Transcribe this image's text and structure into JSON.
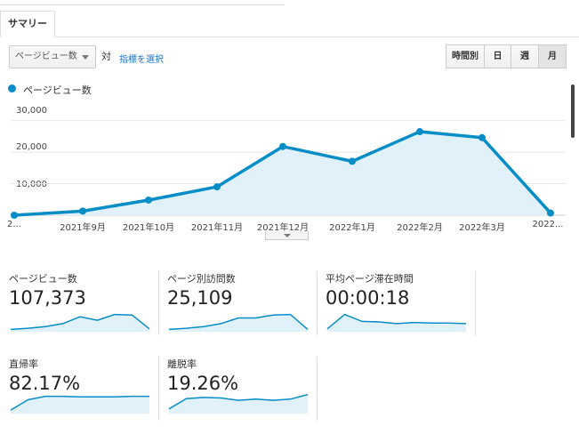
{
  "tabs": [
    {
      "label": "サマリー"
    }
  ],
  "controls": {
    "metric_select": "ページビュー数",
    "versus": "対",
    "select_metric_link": "指標を選択",
    "granularity": [
      "時間別",
      "日",
      "週",
      "月"
    ],
    "granularity_selected": "月"
  },
  "colors": {
    "accent": "#058dc7",
    "fill": "#e1f1fa",
    "link": "#1a73c8"
  },
  "chart_data": {
    "type": "area",
    "legend": "ページビュー数",
    "ylim": [
      0,
      33000
    ],
    "yticks": [
      "30,000",
      "20,000",
      "10,000"
    ],
    "ytick_values": [
      30000,
      20000,
      10000
    ],
    "x": [
      "2...",
      "2021年9月",
      "2021年10月",
      "2021年11月",
      "2021年12月",
      "2022年1月",
      "2022年2月",
      "2022年3月",
      "2022..."
    ],
    "series": [
      {
        "name": "ページビュー数",
        "values": [
          0,
          1300,
          4800,
          9000,
          21800,
          17100,
          26500,
          24600,
          700
        ]
      }
    ],
    "grid": true
  },
  "metrics": [
    {
      "label": "ページビュー数",
      "value": "107,373",
      "spark": [
        4,
        6,
        9,
        14,
        26,
        20,
        30,
        29,
        5
      ]
    },
    {
      "label": "ページ別訪問数",
      "value": "25,109",
      "spark": [
        4,
        6,
        9,
        14,
        24,
        24,
        29,
        30,
        4
      ]
    },
    {
      "label": "平均ページ滞在時間",
      "value": "00:00:18",
      "spark": [
        5,
        30,
        18,
        17,
        14,
        16,
        15,
        15,
        14
      ]
    },
    {
      "label": "直帰率",
      "value": "82.17%",
      "spark": [
        6,
        24,
        30,
        30,
        29,
        29,
        29,
        30,
        30
      ]
    },
    {
      "label": "離脱率",
      "value": "19.26%",
      "spark": [
        8,
        26,
        28,
        27,
        23,
        25,
        23,
        25,
        33
      ]
    }
  ]
}
